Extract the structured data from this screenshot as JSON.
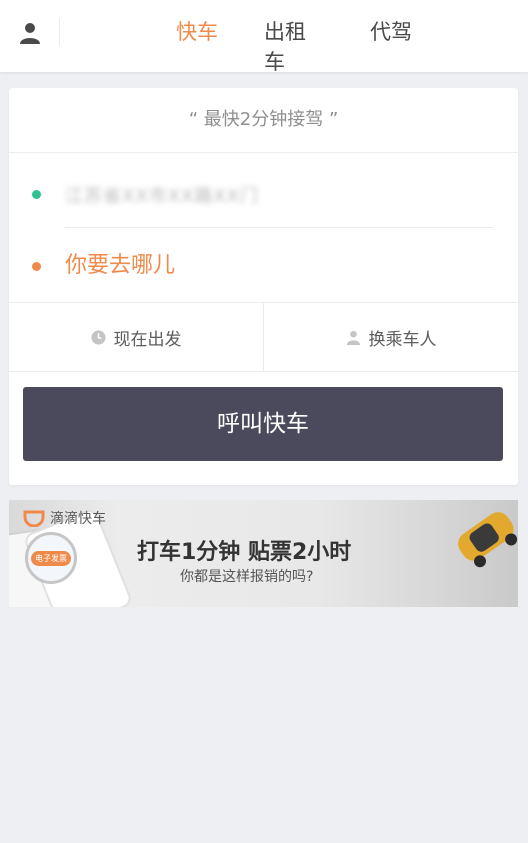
{
  "header": {
    "tabs": [
      {
        "label": "快车",
        "active": true
      },
      {
        "label": "出租车",
        "active": false
      },
      {
        "label": "代驾",
        "active": false
      }
    ],
    "user_icon": "user-icon"
  },
  "ride_card": {
    "slogan": "“ 最快2分钟接驾 ”",
    "from_text": "江苏省XX市XX路XX门",
    "to_placeholder": "你要去哪儿",
    "options": {
      "time_label": "现在出发",
      "time_icon": "clock-icon",
      "rider_label": "换乘车人",
      "rider_icon": "person-icon"
    },
    "call_button_label": "呼叫快车"
  },
  "banner": {
    "brand_name": "滴滴快车",
    "headline": "打车1分钟  贴票2小时",
    "subline": "你都是这样报销的吗?",
    "tag_text": "电子发票"
  },
  "colors": {
    "accent": "#f08a4b",
    "origin_dot": "#2ec28e",
    "button_bg": "#4b4a5c",
    "page_bg": "#eeeff2"
  }
}
